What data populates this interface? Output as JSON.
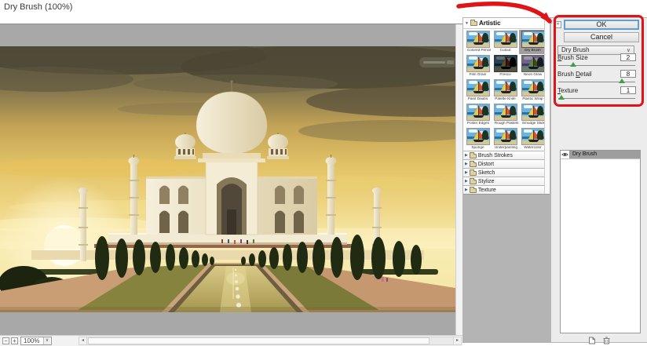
{
  "title": "Dry Brush (100%)",
  "icons": {
    "triangle_down": "▼",
    "triangle_right": "▶",
    "chevron_down": "∨",
    "arrow_left": "◂",
    "arrow_right": "▸",
    "minus": "−",
    "plus": "+",
    "collapse": "«"
  },
  "preview": {
    "zoom_level": "100%"
  },
  "filter_gallery": {
    "expanded_category": {
      "label": "Artistic"
    },
    "filters": [
      {
        "label": "Colored Pencil"
      },
      {
        "label": "Cutout"
      },
      {
        "label": "Dry Brush",
        "selected": true
      },
      {
        "label": "Film Grain"
      },
      {
        "label": "Fresco",
        "variant": "dark"
      },
      {
        "label": "Neon Glow",
        "variant": "purple"
      },
      {
        "label": "Paint Daubs"
      },
      {
        "label": "Palette Knife"
      },
      {
        "label": "Plastic Wrap"
      },
      {
        "label": "Poster Edges"
      },
      {
        "label": "Rough Pastels"
      },
      {
        "label": "Smudge Stick"
      },
      {
        "label": "Sponge"
      },
      {
        "label": "Underpainting"
      },
      {
        "label": "Watercolor",
        "variant": "palm"
      }
    ],
    "collapsed_categories": [
      "Brush Strokes",
      "Distort",
      "Sketch",
      "Stylize",
      "Texture"
    ]
  },
  "controls": {
    "ok_label": "OK",
    "cancel_label": "Cancel",
    "filter_select": "Dry Brush",
    "sliders": [
      {
        "label": "Brush Size",
        "u": 0,
        "value": "2",
        "percent": 20
      },
      {
        "label": "Brush Detail",
        "u": 6,
        "value": "8",
        "percent": 82
      },
      {
        "label": "Texture",
        "u": 0,
        "value": "1",
        "percent": 5
      }
    ]
  },
  "effect_layers": {
    "rows": [
      {
        "label": "Dry Brush",
        "visible": true,
        "selected": true
      }
    ]
  },
  "colors": {
    "annotation_red": "#e01418",
    "focus_blue": "#5e9fd4",
    "slider_green": "#3fa047",
    "canvas_gray": "#a8a8a8"
  }
}
